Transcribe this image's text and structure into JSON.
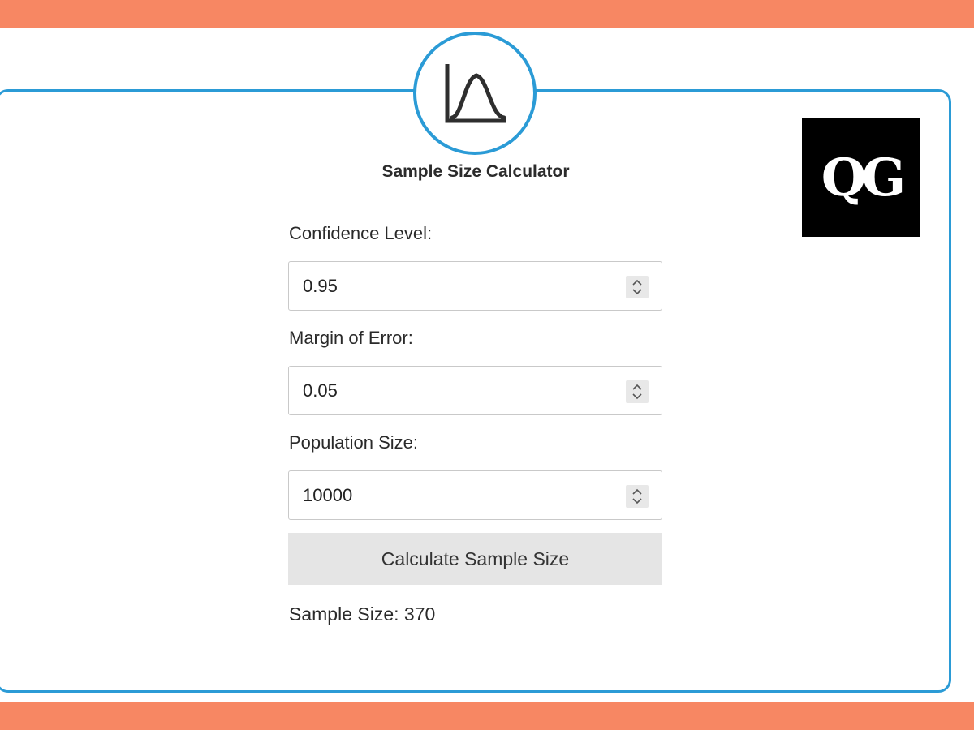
{
  "app": {
    "title": "Sample Size Calculator",
    "logo_text": "QG",
    "badge_icon": "bell-curve-icon"
  },
  "fields": {
    "confidence": {
      "label": "Confidence Level:",
      "value": "0.95"
    },
    "margin": {
      "label": "Margin of Error:",
      "value": "0.05"
    },
    "population": {
      "label": "Population Size:",
      "value": "10000"
    }
  },
  "actions": {
    "calculate_label": "Calculate Sample Size"
  },
  "result": {
    "text": "Sample Size: 370"
  },
  "colors": {
    "accent_orange": "#f78763",
    "accent_blue": "#2b9bd6",
    "button_gray": "#e5e5e5"
  }
}
